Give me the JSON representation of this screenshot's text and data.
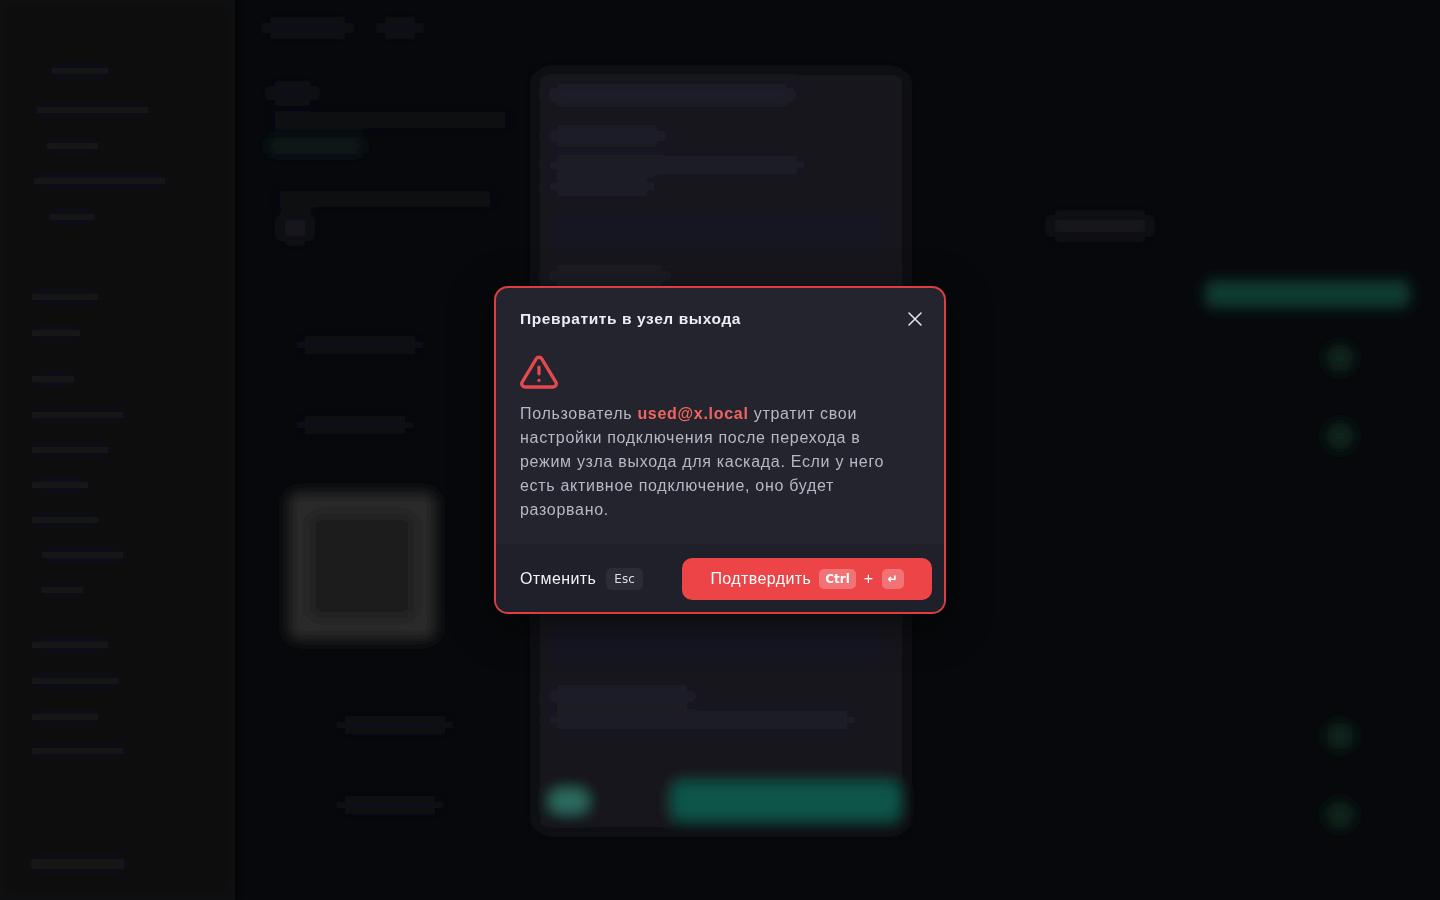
{
  "dialog": {
    "title": "Превратить в узел выхода",
    "message": "Пользователь **used@x.local** утратит свои настройки подключения после перехода в режим узла выхода для каскада. Если у него есть активное подключение, оно будет разорвано.",
    "buttons": [
      {
        "kind": "secondary",
        "label": "Отменить",
        "shortcut": {
          "keys": [
            "Esc"
          ]
        }
      },
      {
        "kind": "danger",
        "label": "Подтвердить",
        "shortcut": {
          "keys": [
            "Ctrl",
            "↵"
          ],
          "joiner": "+"
        }
      }
    ]
  }
}
